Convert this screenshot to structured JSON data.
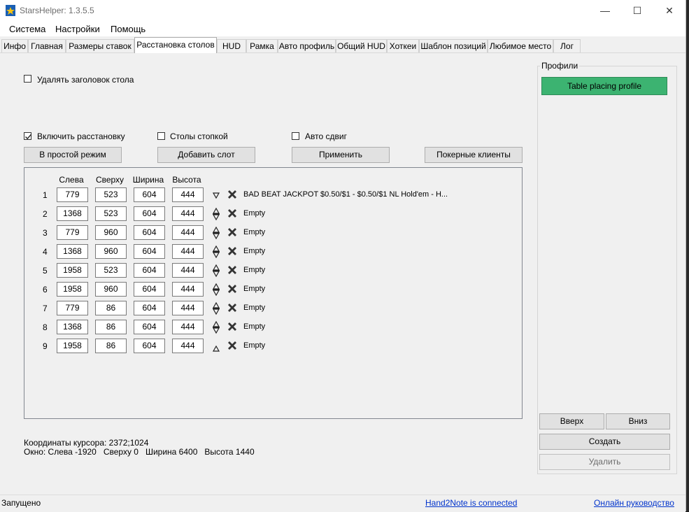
{
  "app": {
    "title": "StarsHelper: 1.3.5.5"
  },
  "window_controls": {
    "minimize": "—",
    "maximize": "☐",
    "close": "✕"
  },
  "menu": [
    "Система",
    "Настройки",
    "Помощь"
  ],
  "tabs": [
    "Инфо",
    "Главная",
    "Размеры ставок",
    "Расстановка столов",
    "HUD",
    "Рамка",
    "Авто профиль",
    "Общий HUD",
    "Хоткеи",
    "Шаблон позиций",
    "Любимое место",
    "Лог"
  ],
  "active_tab": "Расстановка столов",
  "options": {
    "remove_title": {
      "label": "Удалять заголовок стола",
      "checked": false
    },
    "enable_placing": {
      "label": "Включить расстановку",
      "checked": true
    },
    "stack_tables": {
      "label": "Столы стопкой",
      "checked": false
    },
    "auto_shift": {
      "label": "Авто сдвиг",
      "checked": false
    }
  },
  "buttons": {
    "simple_mode": "В простой режим",
    "add_slot": "Добавить слот",
    "apply": "Применить",
    "poker_clients": "Покерные клиенты",
    "up": "Вверх",
    "down": "Вниз",
    "create": "Создать",
    "delete": "Удалить"
  },
  "columns": {
    "left": "Слева",
    "top": "Сверху",
    "width": "Ширина",
    "height": "Высота"
  },
  "slots": [
    {
      "n": "1",
      "left": "779",
      "top": "523",
      "width": "604",
      "height": "444",
      "arrows": "down",
      "table": "BAD BEAT JACKPOT $0.50/$1 - $0.50/$1 NL Hold'em - H..."
    },
    {
      "n": "2",
      "left": "1368",
      "top": "523",
      "width": "604",
      "height": "444",
      "arrows": "both",
      "table": "Empty"
    },
    {
      "n": "3",
      "left": "779",
      "top": "960",
      "width": "604",
      "height": "444",
      "arrows": "both",
      "table": "Empty"
    },
    {
      "n": "4",
      "left": "1368",
      "top": "960",
      "width": "604",
      "height": "444",
      "arrows": "both",
      "table": "Empty"
    },
    {
      "n": "5",
      "left": "1958",
      "top": "523",
      "width": "604",
      "height": "444",
      "arrows": "both",
      "table": "Empty"
    },
    {
      "n": "6",
      "left": "1958",
      "top": "960",
      "width": "604",
      "height": "444",
      "arrows": "both",
      "table": "Empty"
    },
    {
      "n": "7",
      "left": "779",
      "top": "86",
      "width": "604",
      "height": "444",
      "arrows": "both",
      "table": "Empty"
    },
    {
      "n": "8",
      "left": "1368",
      "top": "86",
      "width": "604",
      "height": "444",
      "arrows": "both",
      "table": "Empty"
    },
    {
      "n": "9",
      "left": "1958",
      "top": "86",
      "width": "604",
      "height": "444",
      "arrows": "up",
      "table": "Empty"
    }
  ],
  "info": {
    "cursor": "Координаты курсора: 2372;1024",
    "window": "Окно: Слева -1920   Сверху 0   Ширина 6400   Высота 1440"
  },
  "profiles": {
    "group_title": "Профили",
    "items": [
      "Table placing profile"
    ],
    "selected_color": "#3cb371"
  },
  "status": {
    "text": "Запущено",
    "hand2note": "Hand2Note is connected",
    "guide": "Онлайн руководство"
  }
}
